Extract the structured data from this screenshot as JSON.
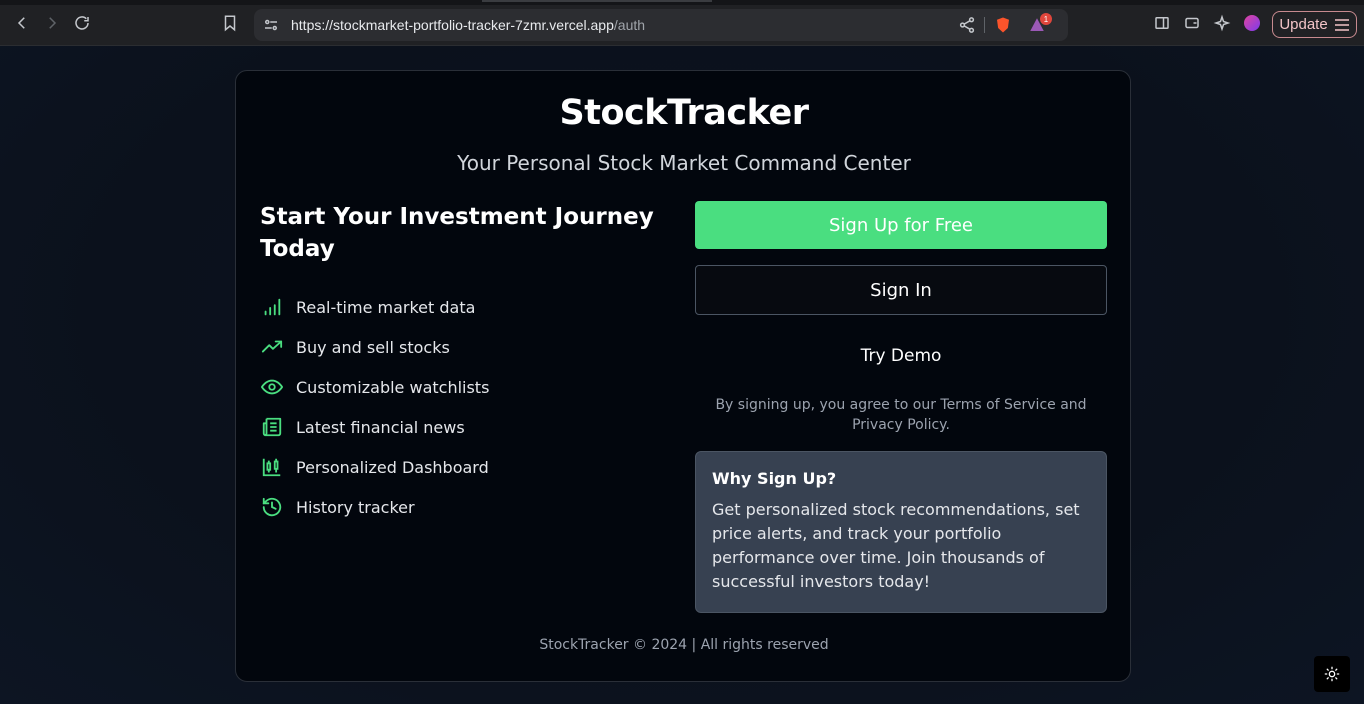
{
  "browser": {
    "url_host": "https://stockmarket-portfolio-tracker-7zmr.vercel.app",
    "url_path": "/auth",
    "badge_count": "1",
    "update_label": "Update"
  },
  "app": {
    "brand": "StockTracker",
    "tagline": "Your Personal Stock Market Command Center"
  },
  "intro": {
    "heading": "Start Your Investment Journey Today",
    "features": [
      {
        "icon": "bar-chart-icon",
        "label": "Real-time market data"
      },
      {
        "icon": "trending-up-icon",
        "label": "Buy and sell stocks"
      },
      {
        "icon": "eye-icon",
        "label": "Customizable watchlists"
      },
      {
        "icon": "newspaper-icon",
        "label": "Latest financial news"
      },
      {
        "icon": "candlestick-chart-icon",
        "label": "Personalized Dashboard"
      },
      {
        "icon": "history-icon",
        "label": "History tracker"
      }
    ]
  },
  "auth": {
    "signup_label": "Sign Up for Free",
    "signin_label": "Sign In",
    "demo_label": "Try Demo",
    "terms": "By signing up, you agree to our Terms of Service and Privacy Policy."
  },
  "why": {
    "title": "Why Sign Up?",
    "body": "Get personalized stock recommendations, set price alerts, and track your portfolio performance over time. Join thousands of successful investors today!"
  },
  "footer": {
    "text": "StockTracker © 2024 | All rights reserved"
  },
  "colors": {
    "accent": "#4ade80",
    "card_bg": "#02060d",
    "page_bg": "#0b111c",
    "why_bg": "#374151"
  }
}
